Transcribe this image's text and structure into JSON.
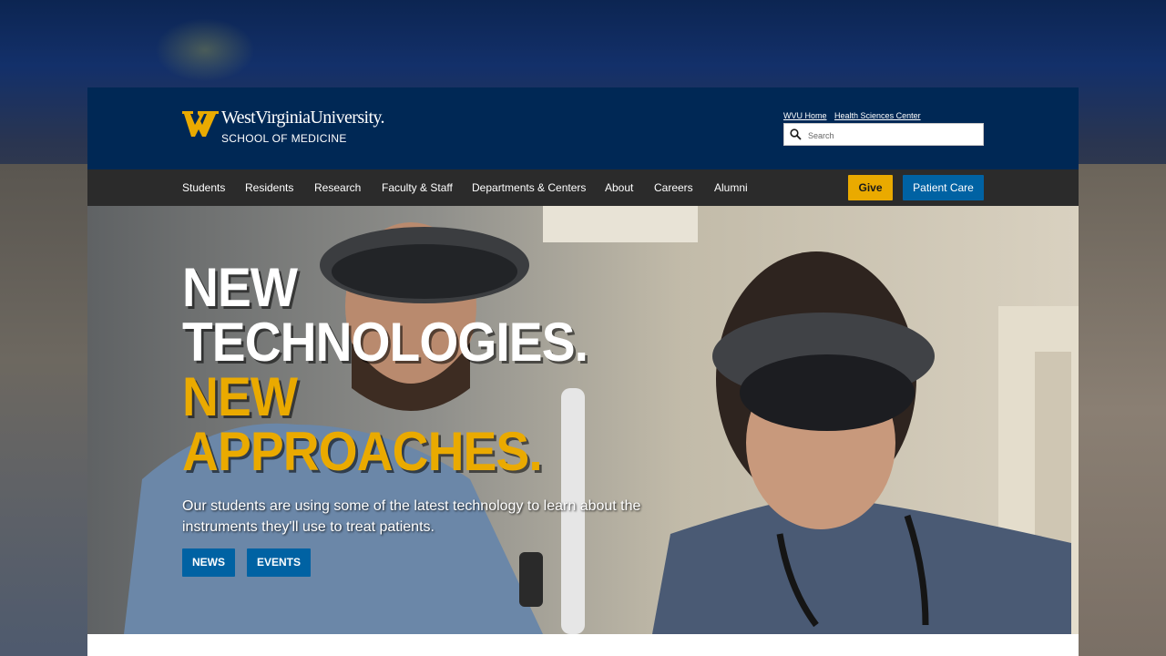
{
  "header": {
    "logo_wordmark": "WestVirginiaUniversity.",
    "logo_school": "SCHOOL OF MEDICINE",
    "utility_links": [
      "WVU Home",
      "Health Sciences Center"
    ],
    "search_placeholder": "Search"
  },
  "nav": {
    "items": [
      "Students",
      "Residents",
      "Research",
      "Faculty & Staff",
      "Departments & Centers",
      "About",
      "Careers",
      "Alumni"
    ],
    "give_label": "Give",
    "patient_care_label": "Patient Care"
  },
  "hero": {
    "line1": "NEW",
    "line2": "TECHNOLOGIES.",
    "line3": "NEW",
    "line4": "APPROACHES.",
    "subtitle": "Our students are using some of the latest technology to learn about the instruments they'll use to treat patients.",
    "news_label": "NEWS",
    "events_label": "EVENTS"
  },
  "colors": {
    "brand_blue": "#002855",
    "gold": "#eaaa00",
    "nav_dark": "#2b2b2b",
    "button_blue": "#0062a3"
  },
  "icons": {
    "logo": "flying-wv-logo-icon",
    "search": "search-icon"
  }
}
